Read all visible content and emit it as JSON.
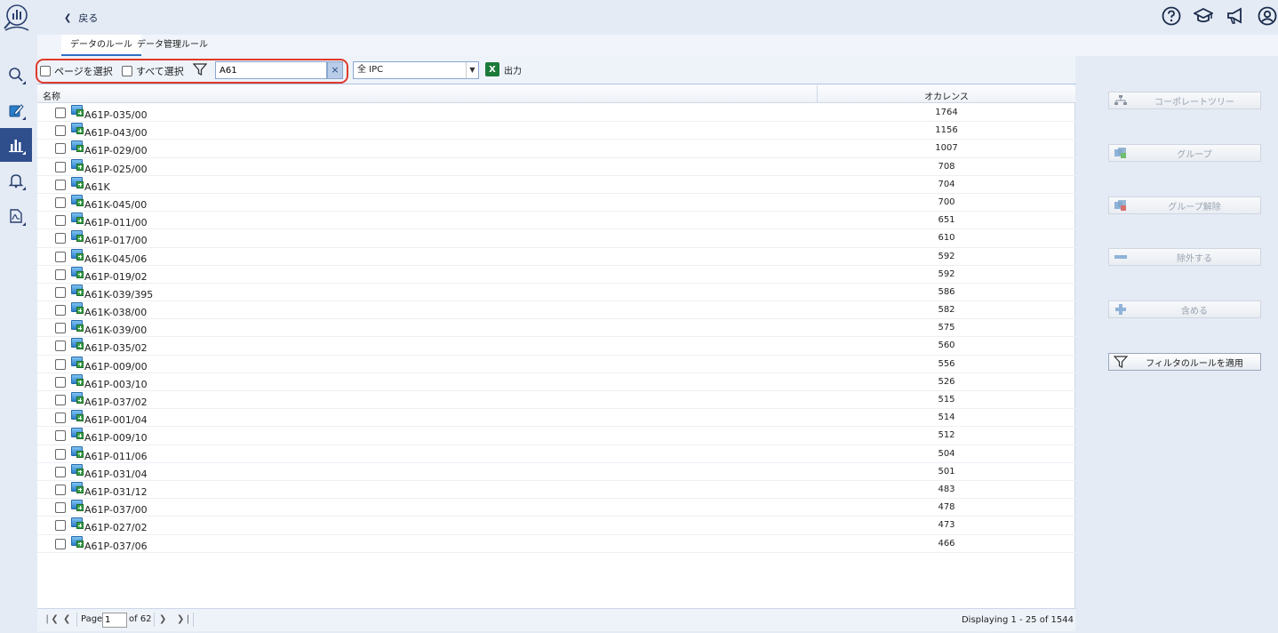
{
  "header": {
    "back_label": "戻る"
  },
  "top_icons": [
    "help-icon",
    "graduation-cap-icon",
    "megaphone-icon",
    "user-account-icon"
  ],
  "nav_icons": [
    "search-icon",
    "edit-icon",
    "chart-icon",
    "bell-icon",
    "pdf-icon"
  ],
  "tabs": [
    {
      "label": "データのルール",
      "active": true
    },
    {
      "label": "データ管理ルール",
      "active": false
    }
  ],
  "toolbar": {
    "select_page_label": "ページを選択",
    "select_all_label": "すべて選択",
    "filter_value": "A61",
    "clear_symbol": "×",
    "ipc_select_value": "全 IPC",
    "export_label": "出力"
  },
  "table": {
    "columns": [
      "名称",
      "オカレンス"
    ],
    "rows": [
      {
        "name": "A61P-035/00",
        "occ": "1764"
      },
      {
        "name": "A61P-043/00",
        "occ": "1156"
      },
      {
        "name": "A61P-029/00",
        "occ": "1007"
      },
      {
        "name": "A61P-025/00",
        "occ": "708"
      },
      {
        "name": "A61K",
        "occ": "704"
      },
      {
        "name": "A61K-045/00",
        "occ": "700"
      },
      {
        "name": "A61P-011/00",
        "occ": "651"
      },
      {
        "name": "A61P-017/00",
        "occ": "610"
      },
      {
        "name": "A61K-045/06",
        "occ": "592"
      },
      {
        "name": "A61P-019/02",
        "occ": "592"
      },
      {
        "name": "A61K-039/395",
        "occ": "586"
      },
      {
        "name": "A61K-038/00",
        "occ": "582"
      },
      {
        "name": "A61K-039/00",
        "occ": "575"
      },
      {
        "name": "A61P-035/02",
        "occ": "560"
      },
      {
        "name": "A61P-009/00",
        "occ": "556"
      },
      {
        "name": "A61P-003/10",
        "occ": "526"
      },
      {
        "name": "A61P-037/02",
        "occ": "515"
      },
      {
        "name": "A61P-001/04",
        "occ": "514"
      },
      {
        "name": "A61P-009/10",
        "occ": "512"
      },
      {
        "name": "A61P-011/06",
        "occ": "504"
      },
      {
        "name": "A61P-031/04",
        "occ": "501"
      },
      {
        "name": "A61P-031/12",
        "occ": "483"
      },
      {
        "name": "A61P-037/00",
        "occ": "478"
      },
      {
        "name": "A61P-027/02",
        "occ": "473"
      },
      {
        "name": "A61P-037/06",
        "occ": "466"
      }
    ]
  },
  "pager": {
    "page_label": "Page",
    "page_value": "1",
    "of_label": "of 62",
    "displaying": "Displaying 1 - 25 of 1544"
  },
  "side_buttons": [
    {
      "label": "コーポレートツリー",
      "icon": "tree-icon",
      "enabled": false
    },
    {
      "label": "グループ",
      "icon": "group-icon",
      "enabled": false
    },
    {
      "label": "グループ解除",
      "icon": "ungroup-icon",
      "enabled": false
    },
    {
      "label": "除外する",
      "icon": "minus-icon",
      "enabled": false
    },
    {
      "label": "含める",
      "icon": "plus-icon",
      "enabled": false
    },
    {
      "label": "フィルタのルールを適用",
      "icon": "filter-icon",
      "enabled": true
    }
  ],
  "colors": {
    "accent": "#2f4e8c",
    "highlight": "#e03a2a",
    "background": "#e4ebf5"
  }
}
